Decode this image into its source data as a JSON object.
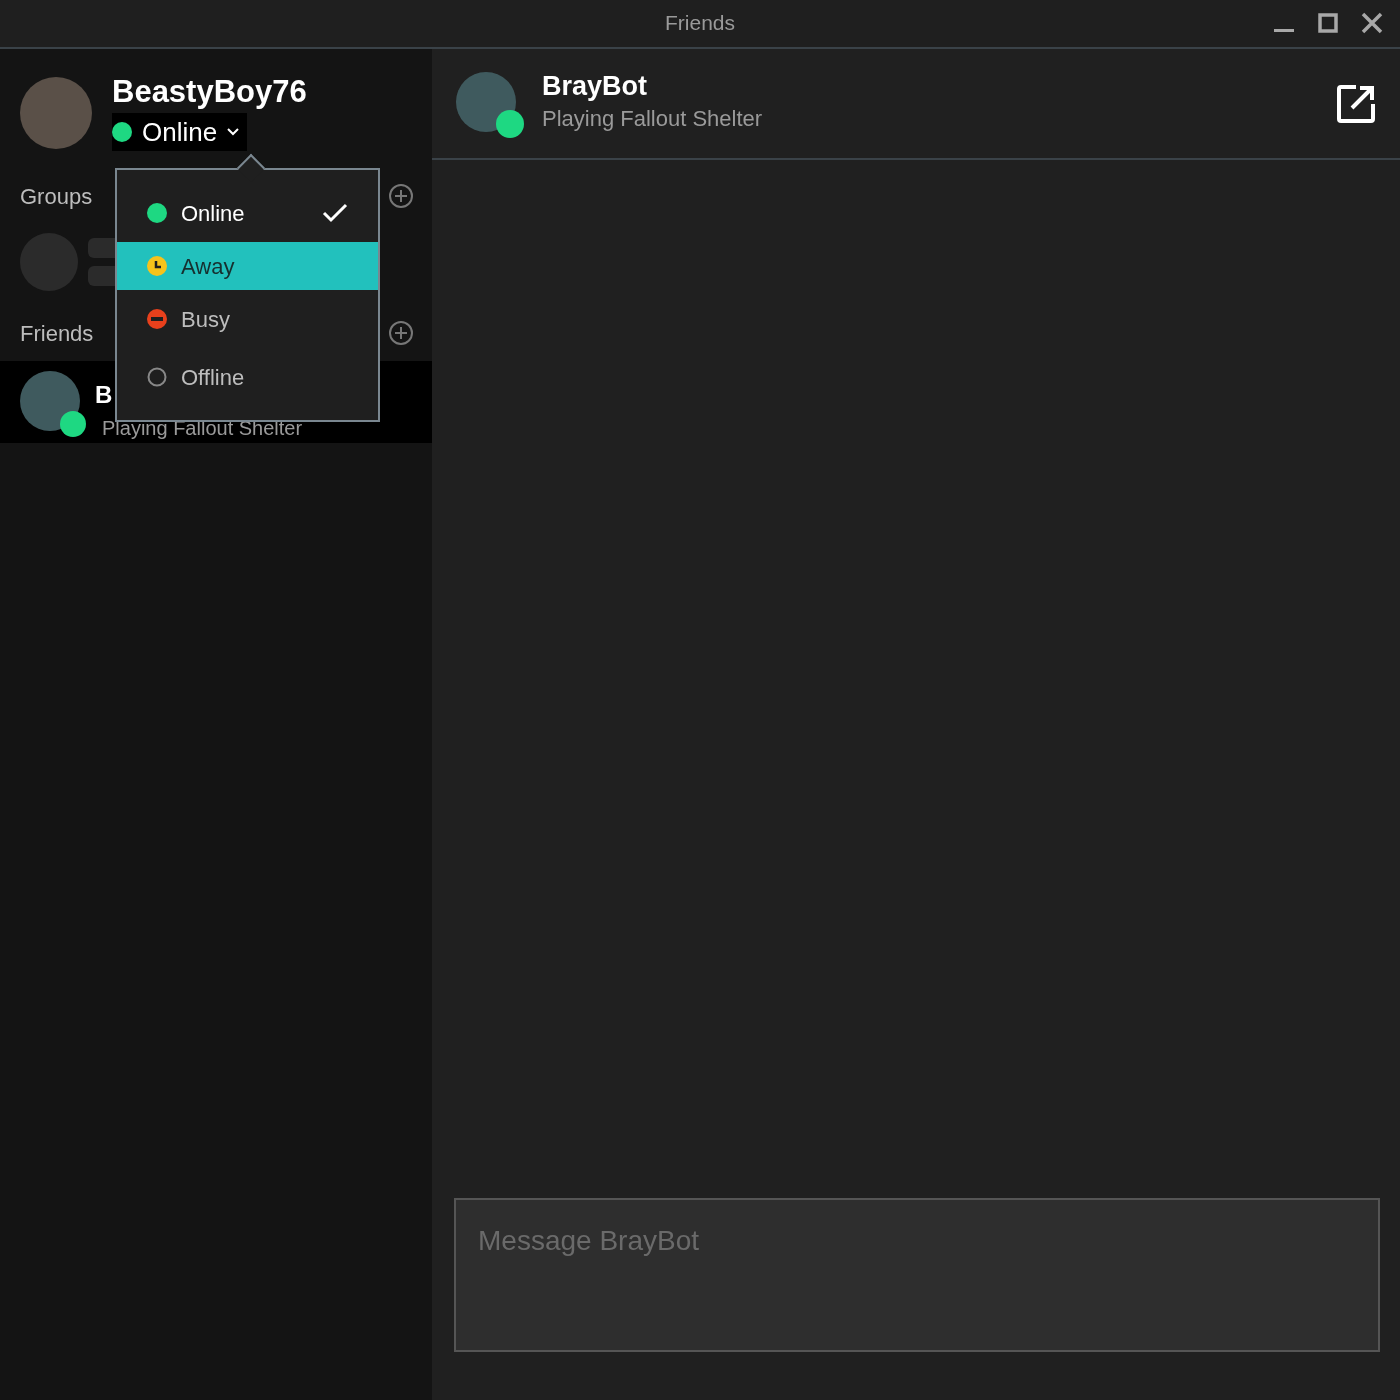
{
  "window": {
    "title": "Friends"
  },
  "user": {
    "name": "BeastyBoy76",
    "status": {
      "label": "Online",
      "kind": "online"
    }
  },
  "status_menu": {
    "expanded": true,
    "items": [
      {
        "label": "Online",
        "kind": "online",
        "checked": true,
        "highlighted": false
      },
      {
        "label": "Away",
        "kind": "away",
        "checked": false,
        "highlighted": true
      },
      {
        "label": "Busy",
        "kind": "busy",
        "checked": false,
        "highlighted": false
      },
      {
        "label": "Offline",
        "kind": "offline",
        "checked": false,
        "highlighted": false
      }
    ]
  },
  "groups": {
    "title": "Groups"
  },
  "friends": {
    "title": "Friends",
    "items": [
      {
        "name": "B",
        "status": "Playing Fallout Shelter",
        "online": true,
        "selected": true
      }
    ]
  },
  "chat": {
    "name": "BrayBot",
    "status": "Playing Fallout Shelter",
    "online": true
  },
  "composer": {
    "placeholder": "Message BrayBot"
  }
}
